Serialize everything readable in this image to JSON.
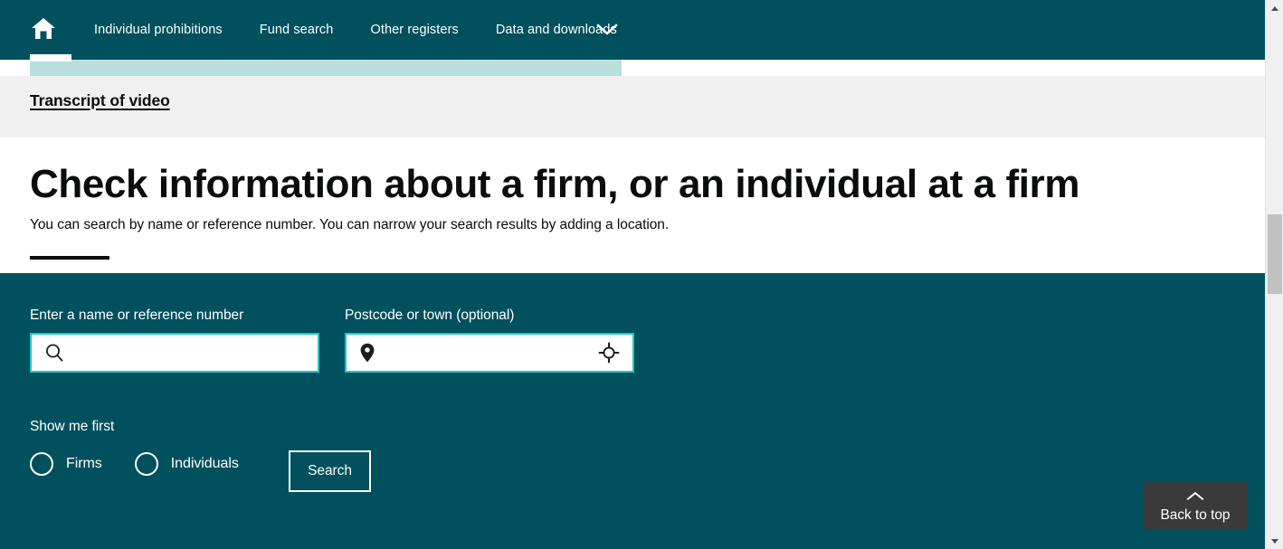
{
  "colors": {
    "brand_teal": "#00505e",
    "light_teal_band": "#b9dfdd",
    "input_border_cyan": "#1ec8c0",
    "grey_strip": "#f0f0f0",
    "text_dark": "#0b0c0c",
    "back_to_top_bg": "#3a3a3a",
    "scrollbar_thumb": "#c1c1c1"
  },
  "navbar": {
    "home_icon": "home-icon",
    "links": [
      {
        "label": "Individual prohibitions"
      },
      {
        "label": "Fund search"
      },
      {
        "label": "Other registers"
      },
      {
        "label": "Data and downloads"
      }
    ],
    "caret_icon": "chevron-down-icon"
  },
  "transcript": {
    "link_label": "Transcript of video"
  },
  "heading": {
    "title": "Check information about a firm, or an individual at a firm",
    "subtitle": "You can search by name or reference number. You can narrow your search results by adding a location."
  },
  "search_panel": {
    "name_field": {
      "label": "Enter a name or reference number",
      "value": "",
      "placeholder": "",
      "icon": "search-icon"
    },
    "postcode_field": {
      "label": "Postcode or town (optional)",
      "value": "",
      "placeholder": "",
      "icon_left": "map-pin-icon",
      "icon_right": "locate-crosshair-icon"
    },
    "show_me_first": {
      "label": "Show me first",
      "options": [
        {
          "label": "Firms",
          "selected": false
        },
        {
          "label": "Individuals",
          "selected": false
        }
      ]
    },
    "search_button_label": "Search"
  },
  "back_to_top": {
    "label": "Back to top",
    "icon": "chevron-up-icon"
  },
  "scrollbar": {
    "up_icon": "scroll-up-arrow-icon",
    "down_icon": "scroll-down-arrow-icon"
  }
}
